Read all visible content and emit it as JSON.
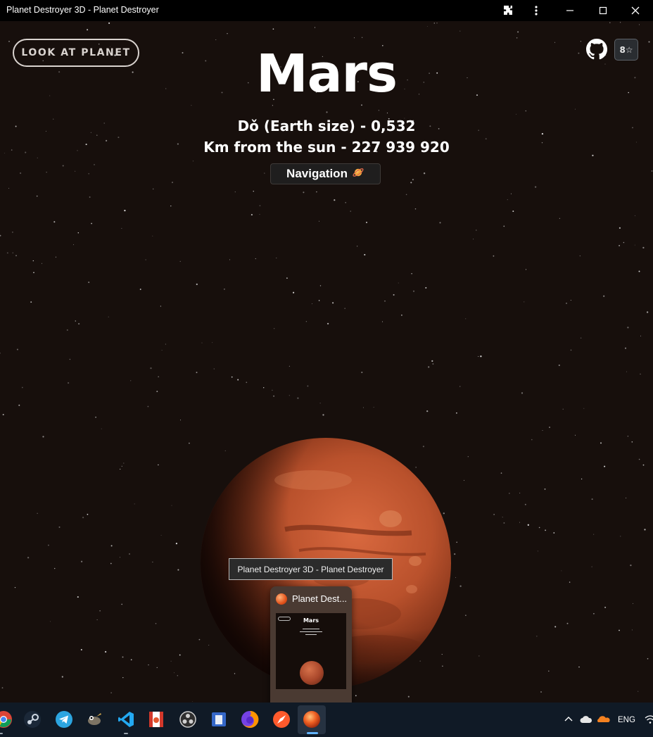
{
  "window": {
    "title": "Planet Destroyer 3D - Planet Destroyer"
  },
  "header": {
    "look_button_label": "LOOK AT PLANET",
    "github_stars": "8☆"
  },
  "planet": {
    "name": "Mars",
    "size_text": "Dǒ (Earth size) - 0,532",
    "distance_text": "Km from the sun - 227 939 920",
    "navigation_label": "Navigation",
    "navigation_icon": "ringed-planet-emoji"
  },
  "tooltip": {
    "text": "Planet Destroyer 3D - Planet Destroyer"
  },
  "preview": {
    "title": "Planet Dest...",
    "thumb_planet_name": "Mars"
  },
  "taskbar": {
    "apps": [
      "chrome",
      "steam",
      "telegram",
      "gimp",
      "vscode",
      "anki",
      "obs",
      "notes",
      "firefox",
      "safari-like",
      "planet-destroyer"
    ],
    "active_app": "planet-destroyer",
    "language": "ENG"
  },
  "colors": {
    "background": "#170f0c",
    "mars": "#c0552f",
    "taskbar": "#101a26"
  }
}
